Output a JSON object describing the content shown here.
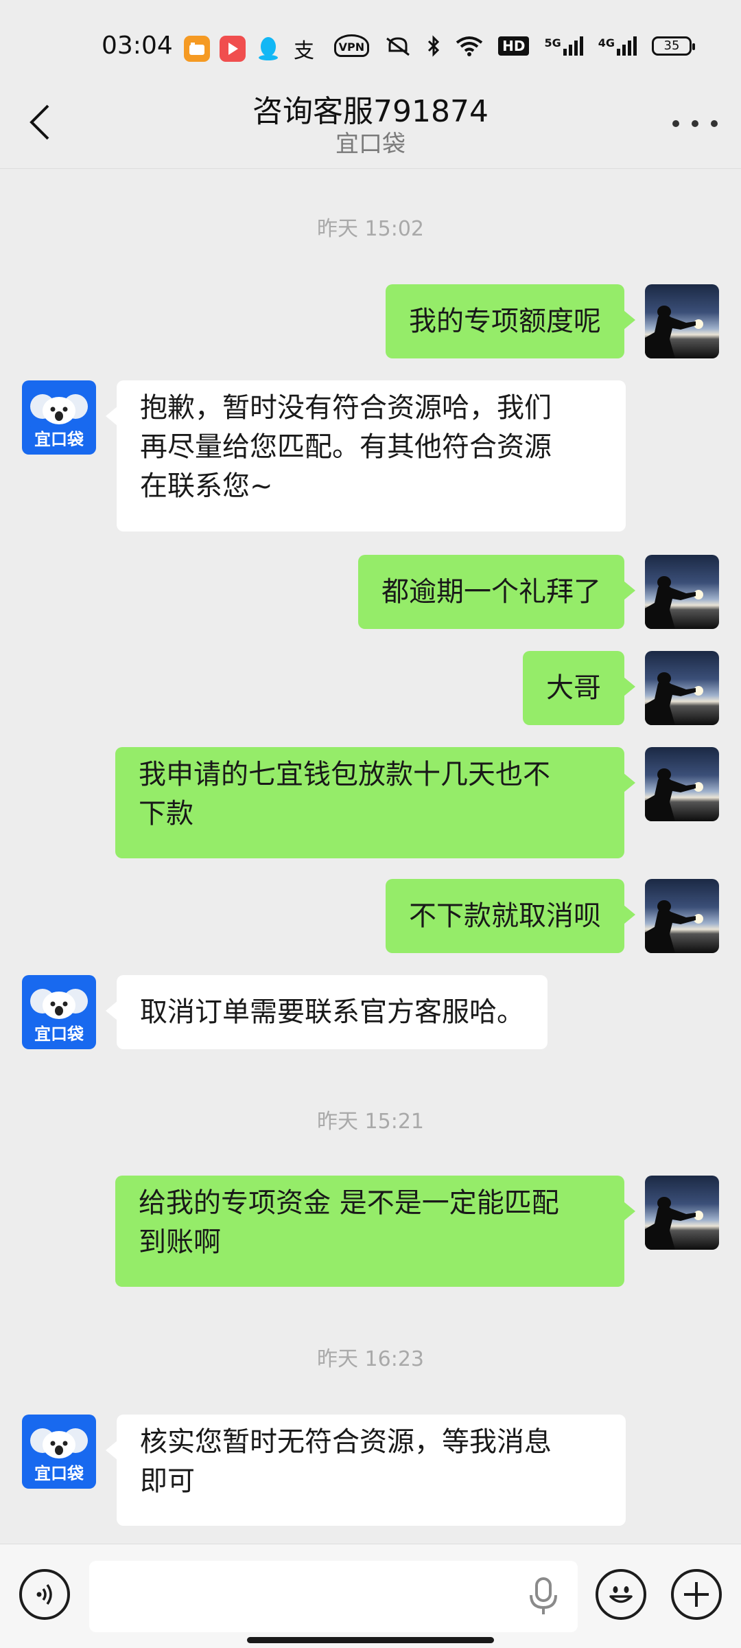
{
  "status_bar": {
    "time": "03:04",
    "icons": [
      "video-app-icon",
      "play-app-icon",
      "qq-icon",
      "alipay-icon",
      "vpn-icon",
      "mute-icon",
      "bluetooth-icon",
      "wifi-icon",
      "hd-icon",
      "signal-5g-icon",
      "signal-4g-icon"
    ],
    "network_5g": "5G",
    "network_4g": "4G",
    "hd_label": "HD",
    "vpn_label": "VPN",
    "alipay_glyph": "支",
    "battery": "35"
  },
  "header": {
    "title": "咨询客服791874",
    "subtitle": "宜口袋"
  },
  "bot_avatar_label": "宜口袋",
  "messages": [
    {
      "type": "time",
      "text": "昨天 15:02"
    },
    {
      "type": "out",
      "text": "我的专项额度呢"
    },
    {
      "type": "in",
      "lines": [
        "抱歉，暂时没有符合资源哈，我们",
        "再尽量给您匹配。有其他符合资源",
        "在联系您~"
      ]
    },
    {
      "type": "out",
      "text": "都逾期一个礼拜了"
    },
    {
      "type": "out",
      "text": "大哥"
    },
    {
      "type": "out",
      "lines": [
        "我申请的七宜钱包放款十几天也不",
        "下款"
      ]
    },
    {
      "type": "out",
      "text": "不下款就取消呗"
    },
    {
      "type": "in",
      "text": "取消订单需要联系官方客服哈。"
    },
    {
      "type": "time",
      "text": "昨天 15:21"
    },
    {
      "type": "out",
      "lines": [
        "给我的专项资金 是不是一定能匹配",
        "到账啊"
      ]
    },
    {
      "type": "time",
      "text": "昨天 16:23"
    },
    {
      "type": "in",
      "lines": [
        "核实您暂时无符合资源，等我消息",
        "即可"
      ]
    }
  ],
  "input": {
    "value": "",
    "placeholder": ""
  }
}
